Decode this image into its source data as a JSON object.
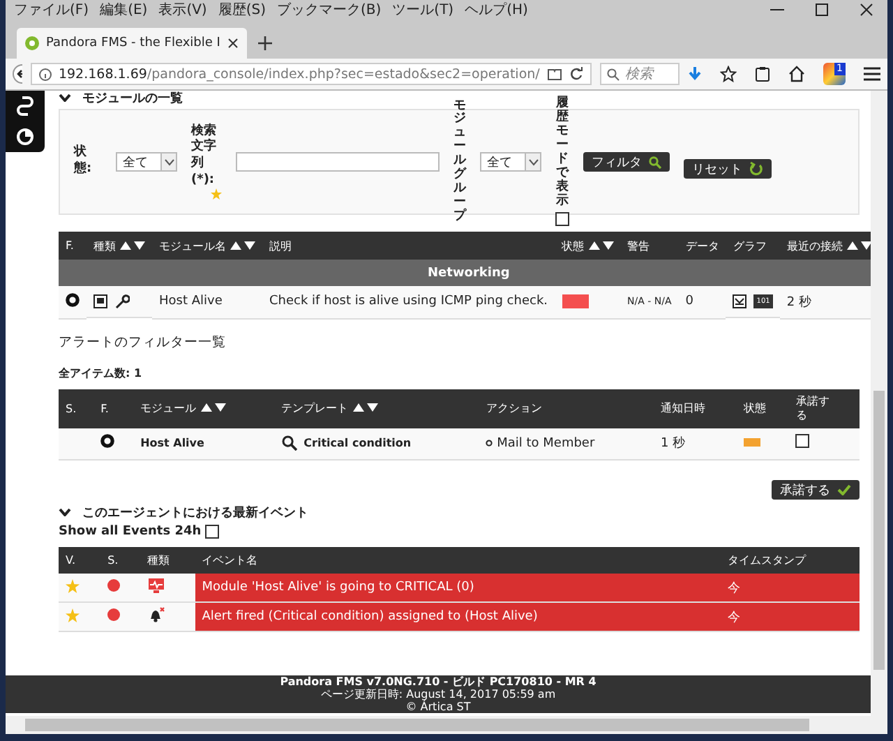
{
  "browser": {
    "menu": [
      "ファイル(F)",
      "編集(E)",
      "表示(V)",
      "履歴(S)",
      "ブックマーク(B)",
      "ツール(T)",
      "ヘルプ(H)"
    ],
    "tab_title": "Pandora FMS - the Flexible I",
    "url_host": "192.168.1.69",
    "url_path": "/pandora_console/index.php?sec=estado&sec2=operation/",
    "search_placeholder": "検索",
    "badge": "1"
  },
  "modules": {
    "title": "モジュールの一覧",
    "filter": {
      "status_label": "状態:",
      "status_value": "全て",
      "search_label": "検索文字列(*):",
      "group_label": "モジュールグループ",
      "group_value": "全て",
      "history_label": "履歴モードで表示",
      "history_checked": false,
      "filter_button": "フィルタ",
      "reset_button": "リセット"
    },
    "columns": [
      {
        "label": "F.",
        "sortable": false
      },
      {
        "label": "種類",
        "sortable": true
      },
      {
        "label": "モジュール名",
        "sortable": true
      },
      {
        "label": "説明",
        "sortable": false
      },
      {
        "label": "状態",
        "sortable": true
      },
      {
        "label": "警告",
        "sortable": false
      },
      {
        "label": "データ",
        "sortable": false
      },
      {
        "label": "グラフ",
        "sortable": false
      },
      {
        "label": "最近の接続",
        "sortable": true
      }
    ],
    "group": "Networking",
    "rows": [
      {
        "name": "Host Alive",
        "description": "Check if host is alive using ICMP ping check.",
        "color": "#f44f4f",
        "warning": "N/A - N/A",
        "data": "0",
        "graph_badge": "101",
        "last": "2 秒"
      }
    ]
  },
  "alerts": {
    "title": "アラートのフィルター一覧",
    "count": "全アイテム数: 1",
    "columns": [
      {
        "label": "S.",
        "sortable": false
      },
      {
        "label": "F.",
        "sortable": false
      },
      {
        "label": "モジュール",
        "sortable": true
      },
      {
        "label": "テンプレート",
        "sortable": true
      },
      {
        "label": "アクション",
        "sortable": false
      },
      {
        "label": "通知日時",
        "sortable": false
      },
      {
        "label": "状態",
        "sortable": false
      },
      {
        "label": "承諾する",
        "sortable": false
      }
    ],
    "rows": [
      {
        "module": "Host Alive",
        "template": "Critical condition",
        "action": "Mail to Member",
        "time": "1 秒",
        "color": "#f3a230",
        "acknowledged": false
      }
    ],
    "validate_button": "承諾する"
  },
  "events": {
    "title": "このエージェントにおける最新イベント",
    "show_all_label": "Show all Events 24h",
    "show_all_checked": false,
    "columns": [
      "V.",
      "S.",
      "種類",
      "イベント名",
      "タイムスタンプ"
    ],
    "rows": [
      {
        "kind": "module",
        "name": "Module 'Host Alive' is going to CRITICAL (0)",
        "timestamp": "今"
      },
      {
        "kind": "alert",
        "name": "Alert fired (Critical condition) assigned to (Host Alive)",
        "timestamp": "今"
      }
    ]
  },
  "footer": [
    "Pandora FMS v7.0NG.710 - ビルド PC170810 - MR 4",
    "ページ更新日時: August 14, 2017 05:59 am",
    "© Ártica ST"
  ]
}
